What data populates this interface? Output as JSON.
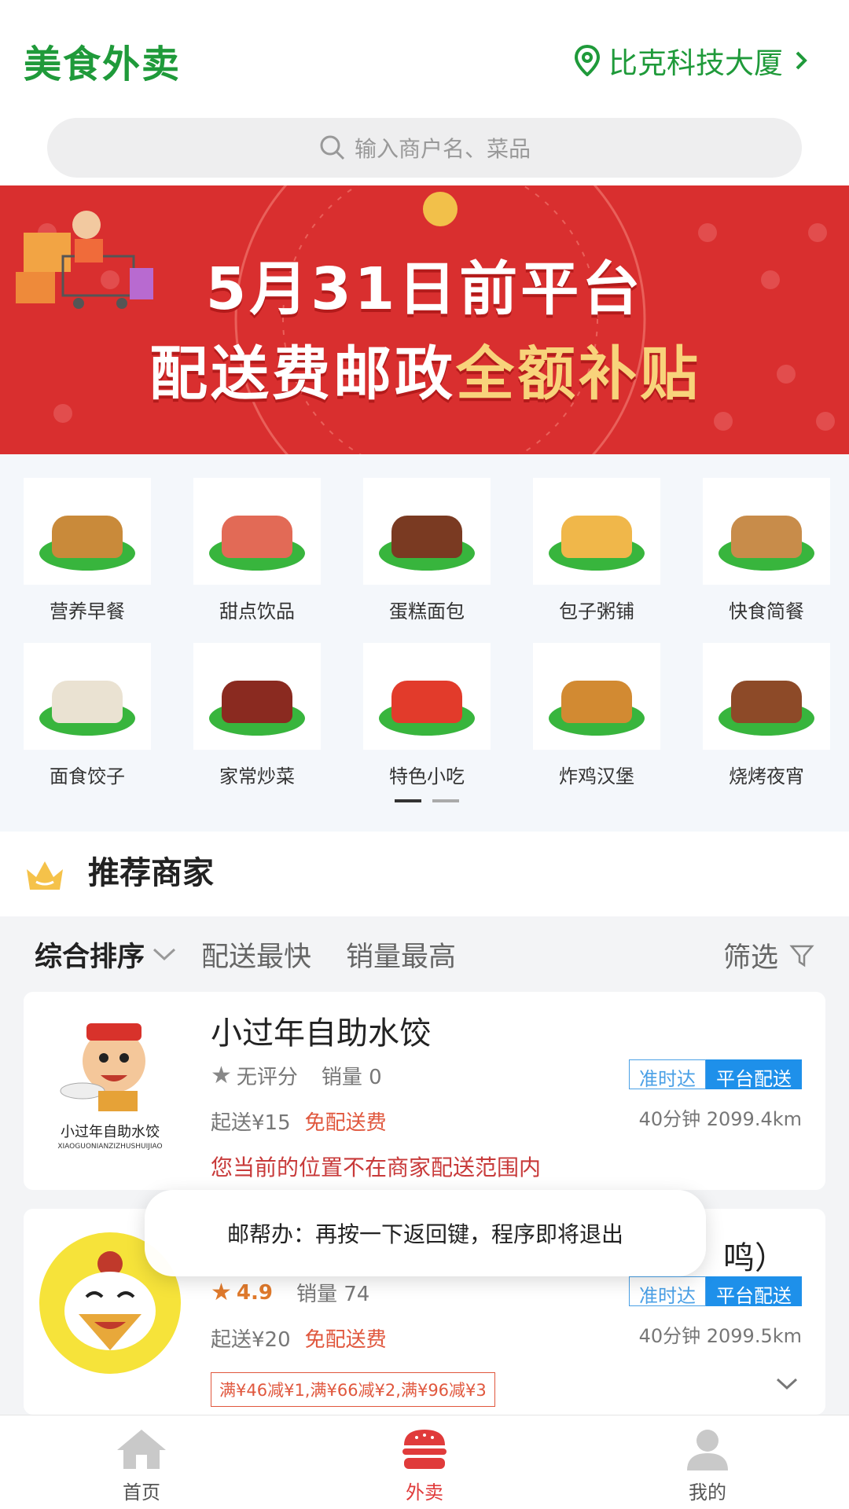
{
  "header": {
    "title": "美食外卖",
    "location": "比克科技大厦"
  },
  "search": {
    "placeholder": "输入商户名、菜品"
  },
  "banner": {
    "line1": "5月31日前平台",
    "line2_prefix": "配送费邮政",
    "line2_highlight": "全额补贴"
  },
  "categories": [
    {
      "label": "营养早餐",
      "color": "#c98a3a"
    },
    {
      "label": "甜点饮品",
      "color": "#e26a56"
    },
    {
      "label": "蛋糕面包",
      "color": "#7a3a22"
    },
    {
      "label": "包子粥铺",
      "color": "#f0b74a"
    },
    {
      "label": "快食简餐",
      "color": "#c88c4a"
    },
    {
      "label": "面食饺子",
      "color": "#eae2d2"
    },
    {
      "label": "家常炒菜",
      "color": "#8a2a20"
    },
    {
      "label": "特色小吃",
      "color": "#e23b2b"
    },
    {
      "label": "炸鸡汉堡",
      "color": "#d28a32"
    },
    {
      "label": "烧烤夜宵",
      "color": "#8d4a28"
    }
  ],
  "recommend": {
    "title": "推荐商家"
  },
  "sort": {
    "items": [
      "综合排序",
      "配送最快",
      "销量最高"
    ],
    "filter": "筛选"
  },
  "shops": [
    {
      "name": "小过年自助水饺",
      "logo_text": "小过年自助水饺",
      "logo_sub": "XIAOGUONIANZIZHUSHUIJIAO",
      "rating": "无评分",
      "sales": "销量 0",
      "min_order": "起送¥15",
      "delivery_fee": "免配送费",
      "badge1": "准时达",
      "badge2": "平台配送",
      "time_dist": "40分钟 2099.4km",
      "warning": "您当前的位置不在商家配送范围内"
    },
    {
      "name_tail": "鸣）",
      "rating": "4.9",
      "sales": "销量 74",
      "min_order": "起送¥20",
      "delivery_fee": "免配送费",
      "badge1": "准时达",
      "badge2": "平台配送",
      "time_dist": "40分钟 2099.5km",
      "promo": "满¥46减¥1,满¥66减¥2,满¥96减¥3"
    }
  ],
  "toast": "邮帮办：再按一下返回键，程序即将退出",
  "tabbar": [
    {
      "label": "首页"
    },
    {
      "label": "外卖"
    },
    {
      "label": "我的"
    }
  ],
  "colors": {
    "brand_green": "#1f9a3a",
    "banner_red": "#d92f2f",
    "accent_red": "#e03b3b",
    "badge_blue": "#1e90ea"
  }
}
